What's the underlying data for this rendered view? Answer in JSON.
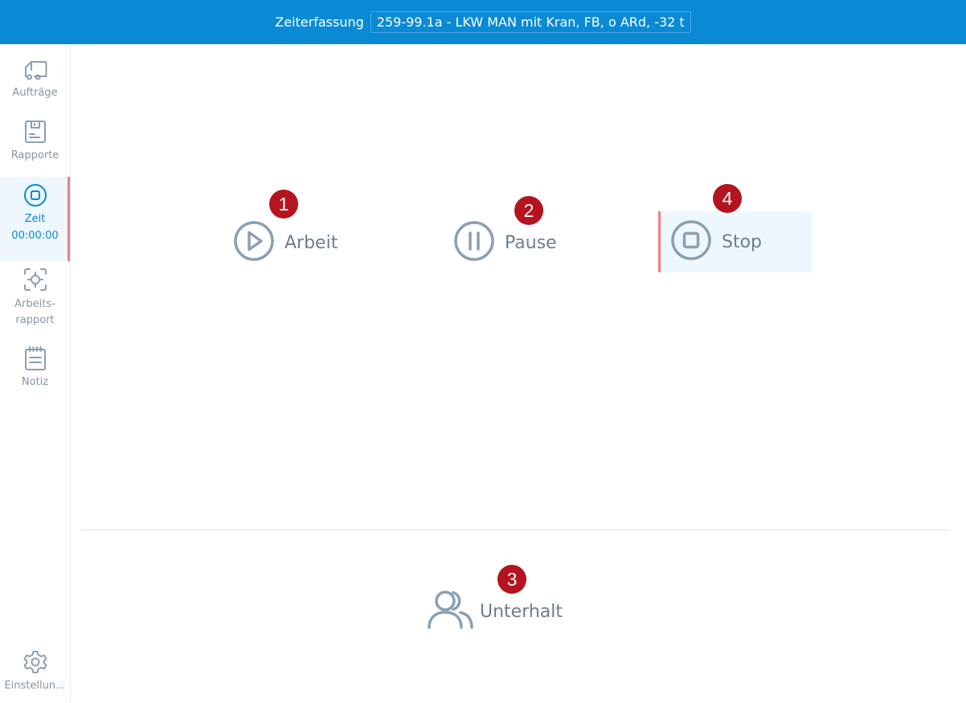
{
  "header": {
    "title": "Zeiterfassung",
    "vehicle": "259-99.1a - LKW MAN mit Kran, FB, o ARd, -32 t"
  },
  "sidebar": {
    "items": [
      {
        "label": "Aufträge",
        "icon": "truck-icon"
      },
      {
        "label": "Rapporte",
        "icon": "report-icon"
      },
      {
        "label": "Zeit",
        "icon": "stop-circle-icon",
        "timer": "00:00:00",
        "active": true
      },
      {
        "label": "Arbeits-\nrapport",
        "icon": "focus-icon"
      },
      {
        "label": "Notiz",
        "icon": "notepad-icon"
      }
    ],
    "settings": {
      "label": "Einstellun...",
      "icon": "gear-icon"
    }
  },
  "actions": {
    "work": {
      "label": "Arbeit",
      "badge": "1",
      "icon": "play-circle-icon"
    },
    "pause": {
      "label": "Pause",
      "badge": "2",
      "icon": "pause-circle-icon"
    },
    "stop": {
      "label": "Stop",
      "badge": "4",
      "icon": "stop-circle-icon",
      "selected": true
    },
    "maintenance": {
      "label": "Unterhalt",
      "badge": "3",
      "icon": "users-icon"
    }
  },
  "colors": {
    "header_bg": "#0a8ad4",
    "accent": "#0a8ad4",
    "active_marker": "#ef7f80",
    "badge": "#b3141f",
    "icon_gray": "#8aa0b3"
  }
}
